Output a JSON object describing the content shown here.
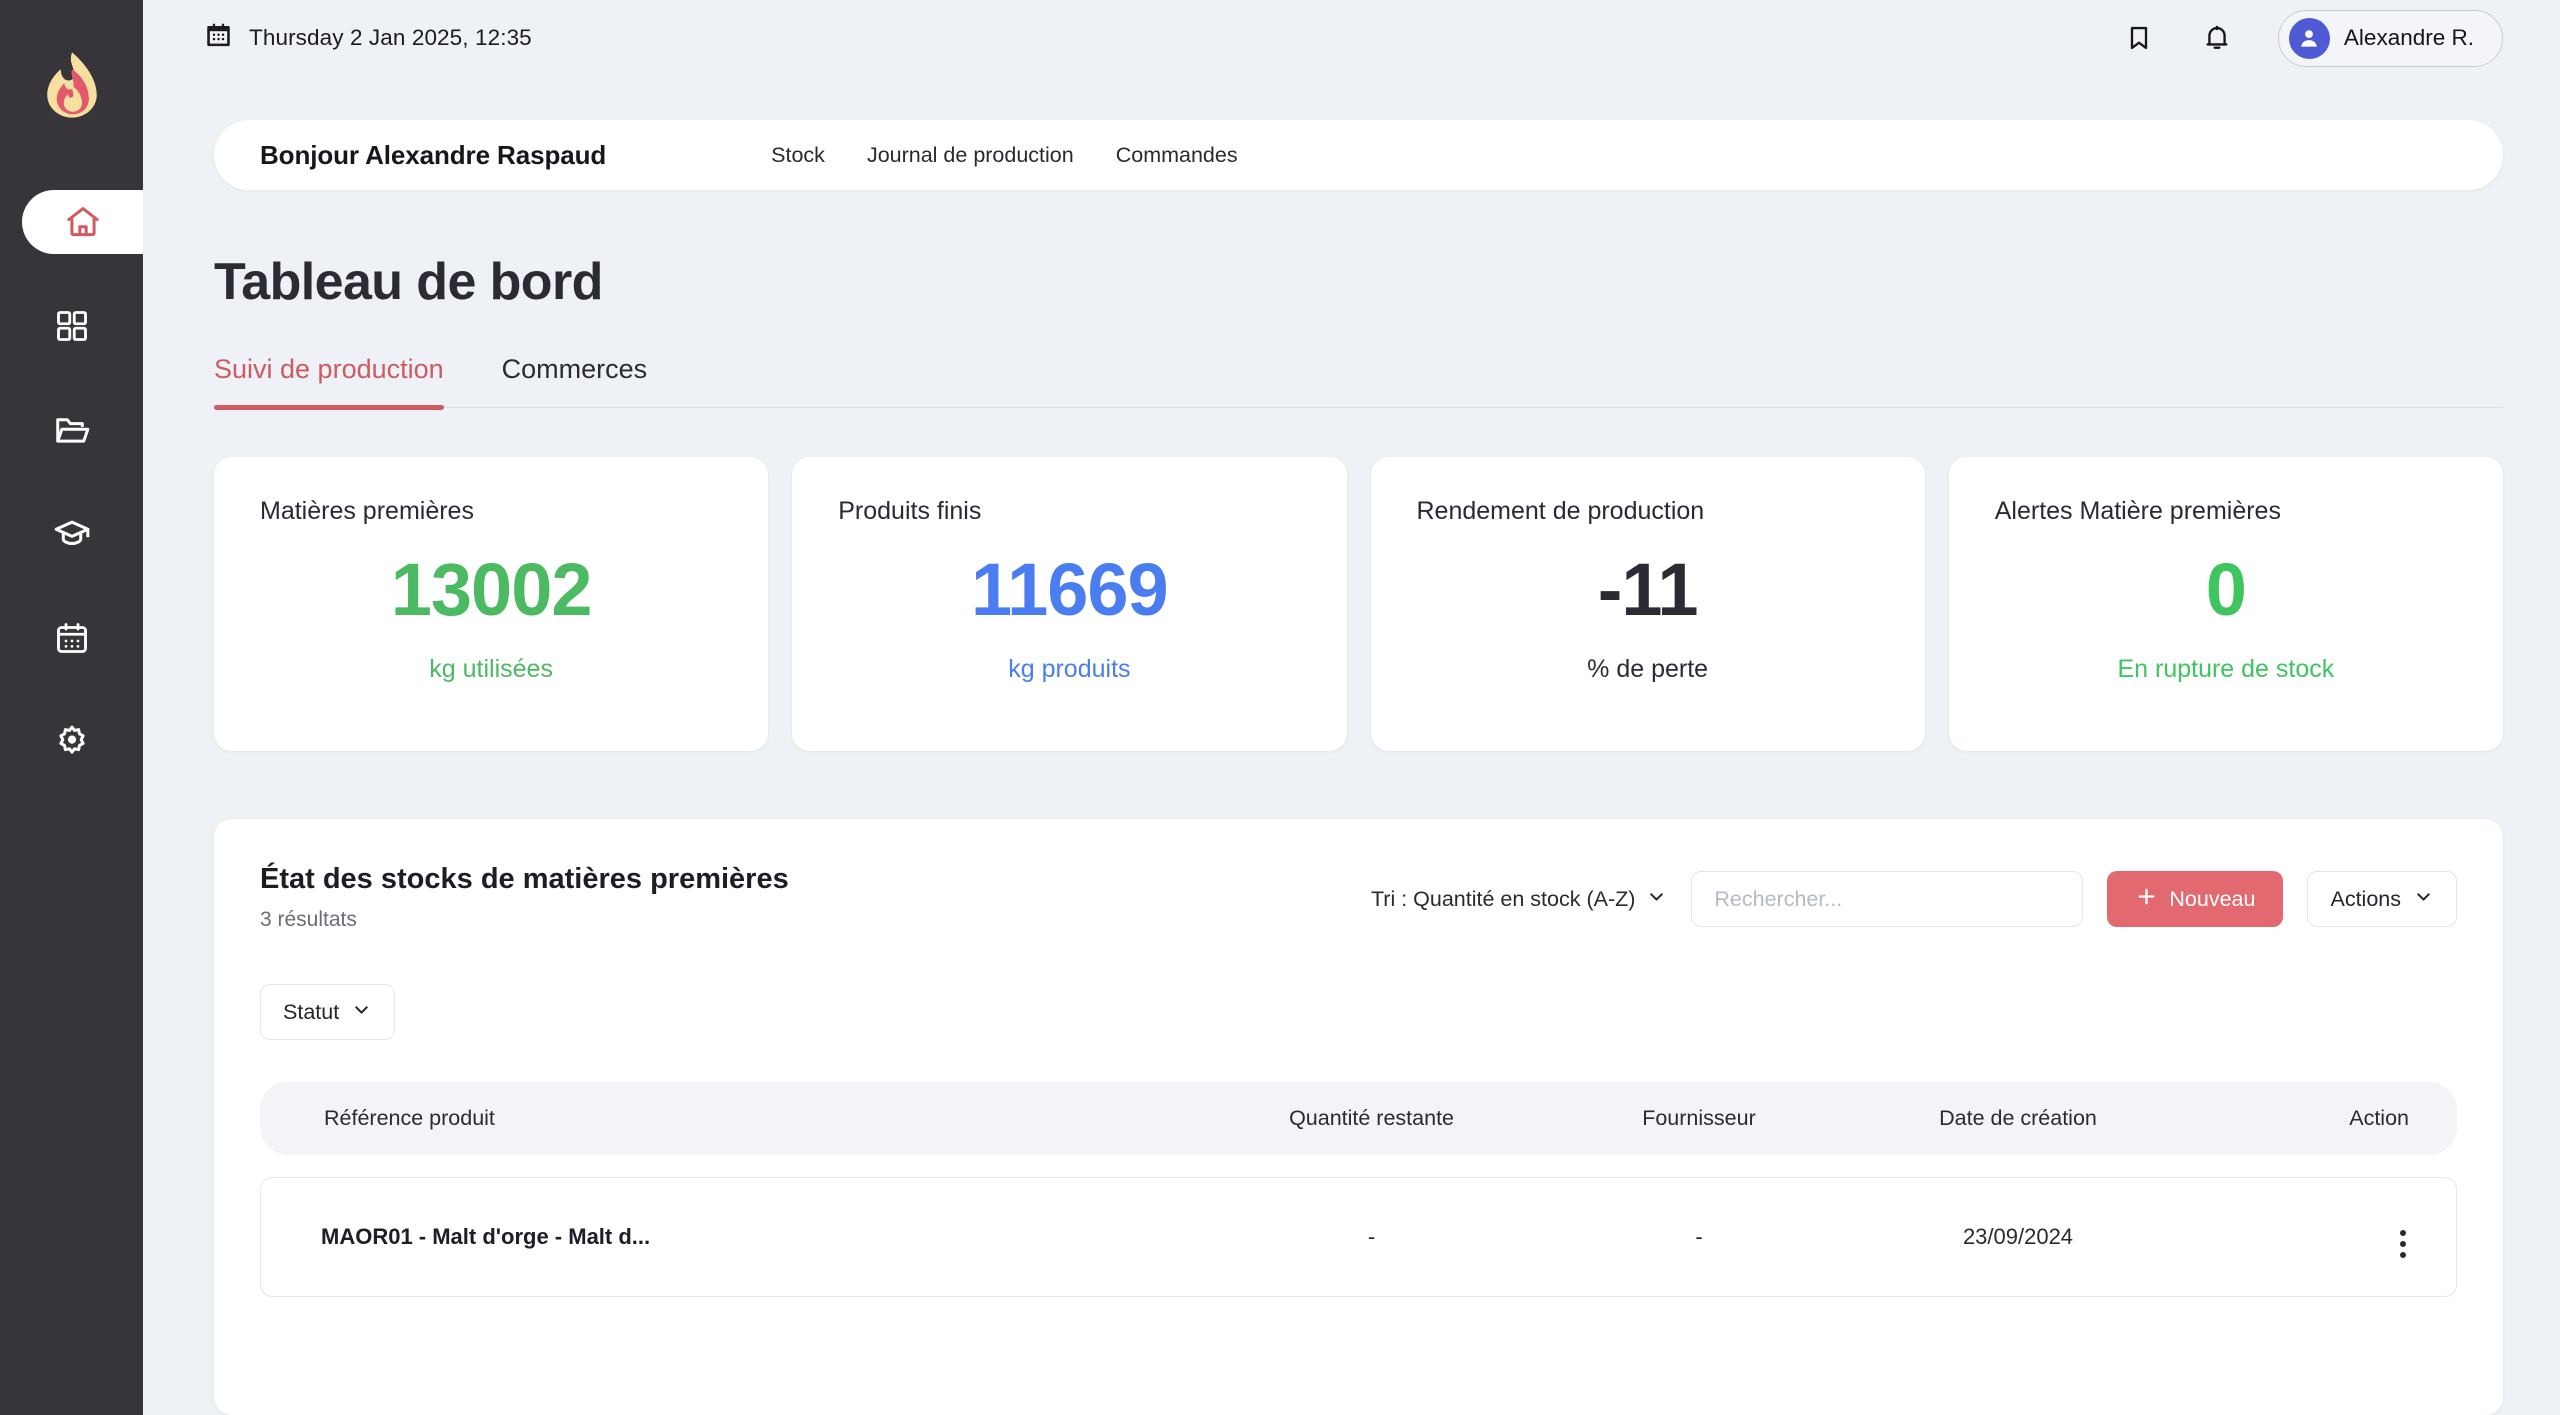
{
  "brand": {
    "logo_icon": "flame-logo",
    "accent": "#cf5a62"
  },
  "sidebar": {
    "items": [
      {
        "icon": "home-icon",
        "name": "home",
        "active": true
      },
      {
        "icon": "grid-icon",
        "name": "apps",
        "active": false
      },
      {
        "icon": "folder-icon",
        "name": "files",
        "active": false
      },
      {
        "icon": "graduation-icon",
        "name": "learning",
        "active": false
      },
      {
        "icon": "calendar-icon",
        "name": "calendar",
        "active": false
      },
      {
        "icon": "gear-icon",
        "name": "settings",
        "active": false
      }
    ]
  },
  "topbar": {
    "calendar_icon": "calendar-icon",
    "date": "Thursday 2 Jan 2025, 12:35",
    "bookmark_icon": "bookmark-icon",
    "bell_icon": "bell-icon",
    "user": {
      "avatar_icon": "user-avatar-icon",
      "name": "Alexandre R."
    }
  },
  "welcome": {
    "greeting": "Bonjour Alexandre Raspaud",
    "links": [
      {
        "label": "Stock"
      },
      {
        "label": "Journal de production"
      },
      {
        "label": "Commandes"
      }
    ]
  },
  "page": {
    "title": "Tableau de bord"
  },
  "tabs": [
    {
      "label": "Suivi de production",
      "active": true
    },
    {
      "label": "Commerces",
      "active": false
    }
  ],
  "kpis": [
    {
      "label": "Matières premières",
      "value": "13002",
      "sub": "kg utilisées",
      "value_color": "#4cb963",
      "sub_color": "#4cb963"
    },
    {
      "label": "Produits finis",
      "value": "11669",
      "sub": "kg produits",
      "value_color": "#4a7ef0",
      "sub_color": "#4a7ef0"
    },
    {
      "label": "Rendement de production",
      "value": "-11",
      "sub": "% de perte",
      "value_color": "#2c2b33",
      "sub_color": "#2c2b33"
    },
    {
      "label": "Alertes Matière premières",
      "value": "0",
      "sub": "En rupture de stock",
      "value_color": "#3fc45f",
      "sub_color": "#3fc45f"
    }
  ],
  "table": {
    "title": "État des stocks de matières premières",
    "count": "3 résultats",
    "sort": {
      "label": "Tri : Quantité en stock (A-Z)",
      "chevron_icon": "chevron-down-icon"
    },
    "search": {
      "value": "",
      "placeholder": "Rechercher..."
    },
    "new_button": {
      "label": "Nouveau",
      "plus_icon": "plus-icon",
      "color": "#e2696f"
    },
    "actions_button": {
      "label": "Actions",
      "chevron_icon": "chevron-down-icon"
    },
    "statut_filter": {
      "label": "Statut",
      "chevron_icon": "chevron-down-icon"
    },
    "columns": [
      "Référence produit",
      "Quantité restante",
      "Fournisseur",
      "Date de création",
      "Action"
    ],
    "rows": [
      {
        "reference": "MAOR01 - Malt d'orge - Malt d...",
        "quantity": "-",
        "supplier": "-",
        "created": "23/09/2024",
        "action_icon": "more-vertical-icon"
      }
    ]
  }
}
